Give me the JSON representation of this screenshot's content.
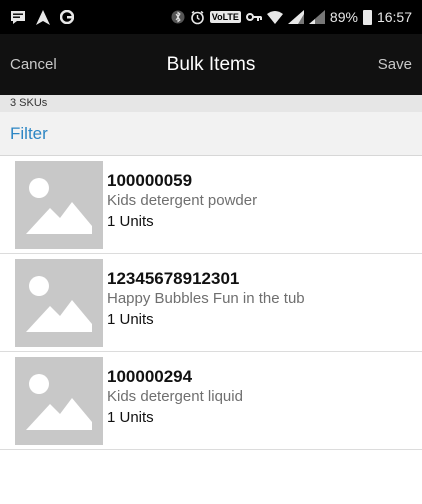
{
  "status_bar": {
    "left_icons": [
      "message-icon",
      "navigation-icon",
      "app-icon"
    ],
    "right_icons": [
      "bluetooth-icon",
      "alarm-icon",
      "volte-icon",
      "vpn-key-icon",
      "wifi-icon",
      "signal-icon",
      "signal-icon"
    ],
    "volte_label": "VoLTE",
    "battery_percent": "89%",
    "time": "16:57"
  },
  "nav": {
    "cancel_label": "Cancel",
    "title": "Bulk Items",
    "save_label": "Save"
  },
  "list_header": {
    "count_text": "3 SKUs",
    "filter_label": "Filter"
  },
  "items": [
    {
      "sku": "100000059",
      "description": "Kids detergent powder",
      "units": "1 Units",
      "thumbnail": "image-placeholder-icon"
    },
    {
      "sku": "12345678912301",
      "description": "Happy Bubbles Fun in the tub",
      "units": "1 Units",
      "thumbnail": "image-placeholder-icon"
    },
    {
      "sku": "100000294",
      "description": "Kids detergent liquid",
      "units": "1 Units",
      "thumbnail": "image-placeholder-icon"
    }
  ],
  "colors": {
    "status_bar": "#000000",
    "nav_bar": "#111111",
    "filter_link": "#2d86c4",
    "thumbnail_bg": "#c8c8c8"
  }
}
